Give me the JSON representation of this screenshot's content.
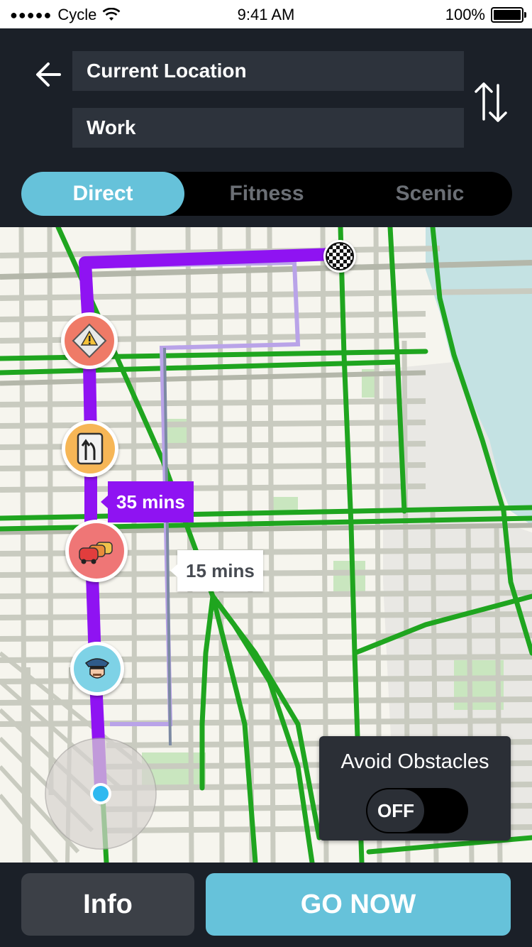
{
  "status_bar": {
    "carrier": "Cycle",
    "time": "9:41 AM",
    "battery": "100%"
  },
  "route": {
    "from": "Current Location",
    "to": "Work"
  },
  "tabs": [
    {
      "label": "Direct",
      "active": true
    },
    {
      "label": "Fitness",
      "active": false
    },
    {
      "label": "Scenic",
      "active": false
    }
  ],
  "map": {
    "primary_route_time": "35 mins",
    "alternate_route_time": "15 mins",
    "colors": {
      "primary_route": "#8f13f2",
      "alternate_route": "#9b8fd8",
      "bike_lanes": "#1fa51f",
      "water": "#c4e2e3"
    },
    "markers": [
      {
        "icon": "hazard-icon"
      },
      {
        "icon": "lane-merge-icon"
      },
      {
        "icon": "traffic-jam-icon"
      },
      {
        "icon": "police-icon"
      },
      {
        "icon": "destination-flag-icon"
      }
    ]
  },
  "avoid_obstacles": {
    "title": "Avoid Obstacles",
    "state": "OFF"
  },
  "bottom": {
    "info_label": "Info",
    "go_label": "GO NOW"
  },
  "accent_color": "#66c2da"
}
